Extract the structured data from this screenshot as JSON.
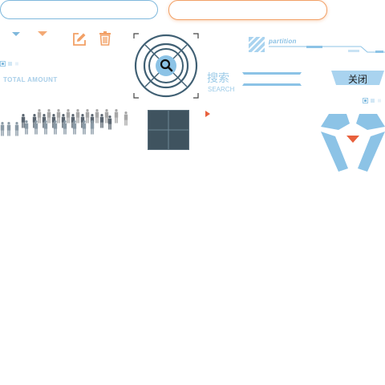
{
  "labels": {
    "total_amount": "TOTAL  AMOUNT",
    "search_cn": "搜索",
    "search_en": "SEARCH",
    "partition": "partition",
    "close": "关闭"
  },
  "colors": {
    "light_blue": "#7fb8dc",
    "orange": "#f2a066",
    "dark_slate": "#3f5f73",
    "accent_red": "#e8603c",
    "pale_blue": "#a9cfe9"
  },
  "icons": [
    "dropdown-arrow-icon",
    "edit-icon",
    "trash-icon",
    "radar-search-icon",
    "partition-icon",
    "arrow-right-icon",
    "shield-emblem-icon",
    "people-crowd-icon"
  ]
}
